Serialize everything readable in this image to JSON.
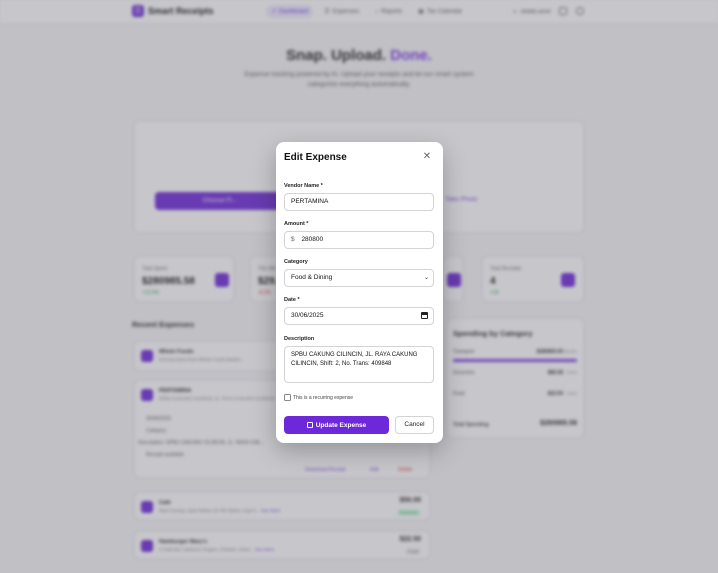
{
  "app": {
    "name": "Smart Receipts",
    "logo_glyph": "☰"
  },
  "nav": {
    "items": [
      {
        "label": "Dashboard",
        "icon": "chart-icon",
        "glyph": "↗",
        "active": true
      },
      {
        "label": "Expenses",
        "icon": "list-icon",
        "glyph": "☰",
        "active": false
      },
      {
        "label": "Reports",
        "icon": "report-icon",
        "glyph": "↕",
        "active": false
      },
      {
        "label": "Tax Calendar",
        "icon": "calendar-icon",
        "glyph": "▣",
        "active": false
      }
    ],
    "user": "shiddo.aroel"
  },
  "hero": {
    "title_main": "Snap. Upload.",
    "title_accent": "Done.",
    "subtitle": "Expense tracking powered by AI. Upload your receipts and let our smart system categorize everything automatically."
  },
  "upload": {
    "choose_label": "Choose Fi...",
    "take_photo_label": "Take Photo"
  },
  "stats": [
    {
      "label": "Total Spent",
      "value": "$280985.58",
      "delta": "+12.5%",
      "negative": false
    },
    {
      "label": "This Mo...",
      "value": "$29...",
      "delta": "-8.2%",
      "negative": true
    },
    {
      "label": "Total Receipts",
      "value": "4",
      "delta": "+18",
      "negative": false
    }
  ],
  "recent": {
    "title": "Recent Expenses",
    "items": [
      {
        "name": "Whole Foods",
        "desc": "Grocery items from Whole Foods Market...",
        "amount": "",
        "badge": ""
      },
      {
        "name": "PERTAMINA",
        "desc": "SPBU CAKUNG CILINCIN, JL. RAYA CAKUNG CILINCIN...",
        "amount": "",
        "badge": ""
      },
      {
        "name": "Cafe",
        "desc": "Nasi Goreng, Ayam Bakar, Es Teh Manis, Kopi S...",
        "more": "See More",
        "amount": "$50.00",
        "badge": "Business"
      },
      {
        "name": "Hamburger Mary's",
        "desc": "2 Club Dirt, Hardcore Fingers, Chicken, Ched...",
        "more": "See More",
        "amount": "$22.50",
        "badge": "Food"
      }
    ],
    "meta": {
      "date": "30/06/2025",
      "category": "Category",
      "description": "Description: SPBU CAKUNG CILINCIN, JL. RAYA CAK...",
      "receipt": "Receipt available"
    },
    "actions": {
      "download": "Download Receipt",
      "edit": "Edit",
      "delete": "Delete"
    }
  },
  "categories": {
    "title": "Spending by Category",
    "rows": [
      {
        "label": "Transport",
        "value": "$280800.00",
        "pct": "99.9%",
        "fill": 0.999
      },
      {
        "label": "Groceries",
        "value": "$85.58",
        "pct": "0.0%",
        "fill": 0.0
      },
      {
        "label": "Food",
        "value": "$22.50",
        "pct": "0.0%",
        "fill": 0.0
      }
    ],
    "total_label": "Total Spending",
    "total_value": "$280985.58"
  },
  "modal": {
    "title": "Edit Expense",
    "vendor_label": "Vendor Name *",
    "vendor_value": "PERTAMINA",
    "amount_label": "Amount *",
    "amount_prefix": "$",
    "amount_value": "280800",
    "category_label": "Category",
    "category_value": "Food & Dining",
    "date_label": "Date *",
    "date_value": "30/06/2025",
    "description_label": "Description",
    "description_value": "SPBU CAKUNG CILINCIN, JL. RAYA CAKUNG CILINCIN, Shift: 2, No. Trans: 409848",
    "recurring_label": "This is a recurring expense",
    "recurring_checked": false,
    "update_label": "Update Expense",
    "cancel_label": "Cancel",
    "close_glyph": "✕"
  },
  "colors": {
    "brand": "#6d28d9",
    "accent": "#7c3aed",
    "success": "#16a34a",
    "danger": "#dc2626"
  }
}
